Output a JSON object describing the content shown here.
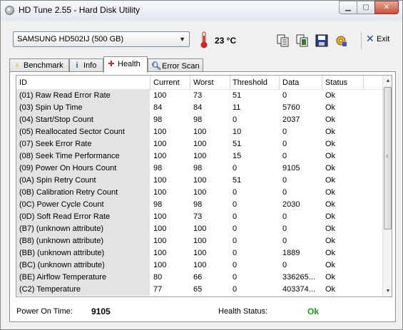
{
  "window": {
    "title": "HD Tune 2.55 - Hard Disk Utility",
    "controls": {
      "minimize": "▁",
      "maximize": "▢",
      "close": "✕"
    }
  },
  "toolbar": {
    "drive": "SAMSUNG HD502IJ (500 GB)",
    "temperature": "23 °C",
    "icons": [
      "copy-icon",
      "copy-all-icon",
      "save-icon",
      "options-icon"
    ],
    "exit_label": "Exit"
  },
  "tabs": [
    {
      "label": "Benchmark",
      "icon": "benchmark-icon",
      "active": false
    },
    {
      "label": "Info",
      "icon": "info-icon",
      "active": false
    },
    {
      "label": "Health",
      "icon": "health-icon",
      "active": true
    },
    {
      "label": "Error Scan",
      "icon": "error-scan-icon",
      "active": false
    }
  ],
  "table": {
    "headers": [
      "ID",
      "Current",
      "Worst",
      "Threshold",
      "Data",
      "Status"
    ],
    "rows": [
      [
        "(01) Raw Read Error Rate",
        "100",
        "73",
        "51",
        "0",
        "Ok"
      ],
      [
        "(03) Spin Up Time",
        "84",
        "84",
        "11",
        "5760",
        "Ok"
      ],
      [
        "(04) Start/Stop Count",
        "98",
        "98",
        "0",
        "2037",
        "Ok"
      ],
      [
        "(05) Reallocated Sector Count",
        "100",
        "100",
        "10",
        "0",
        "Ok"
      ],
      [
        "(07) Seek Error Rate",
        "100",
        "100",
        "51",
        "0",
        "Ok"
      ],
      [
        "(08) Seek Time Performance",
        "100",
        "100",
        "15",
        "0",
        "Ok"
      ],
      [
        "(09) Power On Hours Count",
        "98",
        "98",
        "0",
        "9105",
        "Ok"
      ],
      [
        "(0A) Spin Retry Count",
        "100",
        "100",
        "51",
        "0",
        "Ok"
      ],
      [
        "(0B) Calibration Retry Count",
        "100",
        "100",
        "0",
        "0",
        "Ok"
      ],
      [
        "(0C) Power Cycle Count",
        "98",
        "98",
        "0",
        "2030",
        "Ok"
      ],
      [
        "(0D) Soft Read Error Rate",
        "100",
        "73",
        "0",
        "0",
        "Ok"
      ],
      [
        "(B7) (unknown attribute)",
        "100",
        "100",
        "0",
        "0",
        "Ok"
      ],
      [
        "(B8) (unknown attribute)",
        "100",
        "100",
        "0",
        "0",
        "Ok"
      ],
      [
        "(BB) (unknown attribute)",
        "100",
        "100",
        "0",
        "1889",
        "Ok"
      ],
      [
        "(BC) (unknown attribute)",
        "100",
        "100",
        "0",
        "0",
        "Ok"
      ],
      [
        "(BE) Airflow Temperature",
        "80",
        "66",
        "0",
        "336265...",
        "Ok"
      ],
      [
        "(C2) Temperature",
        "77",
        "65",
        "0",
        "403374...",
        "Ok"
      ]
    ]
  },
  "footer": {
    "power_on_label": "Power On Time:",
    "power_on_value": "9105",
    "health_label": "Health Status:",
    "health_value": "Ok"
  },
  "colors": {
    "health_ok": "#1a9e1a",
    "id_column_bg": "#e3e3e3"
  }
}
